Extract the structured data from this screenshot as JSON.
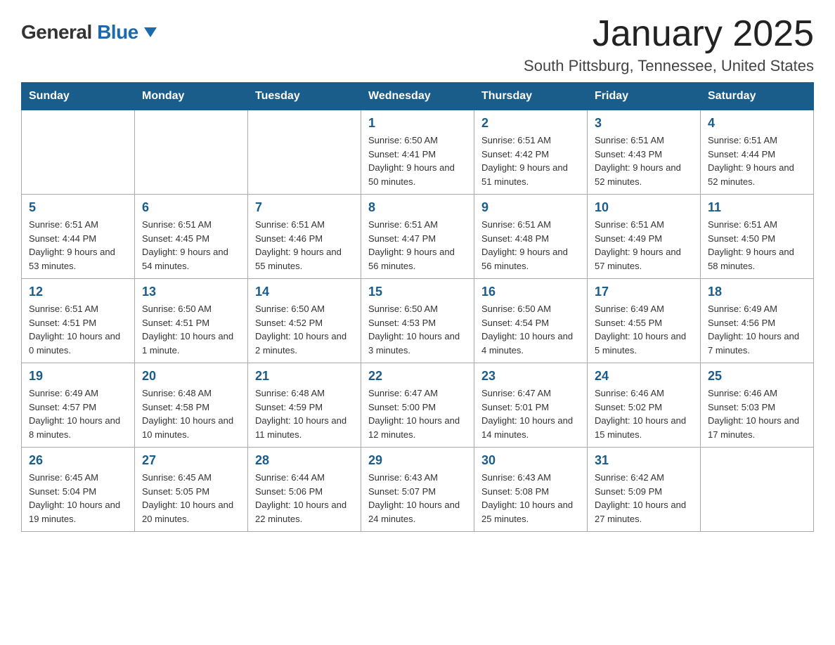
{
  "logo": {
    "text_general": "General",
    "text_blue": "Blue",
    "aria": "GeneralBlue logo"
  },
  "header": {
    "month_title": "January 2025",
    "location": "South Pittsburg, Tennessee, United States"
  },
  "weekdays": [
    "Sunday",
    "Monday",
    "Tuesday",
    "Wednesday",
    "Thursday",
    "Friday",
    "Saturday"
  ],
  "weeks": [
    [
      {
        "day": "",
        "info": ""
      },
      {
        "day": "",
        "info": ""
      },
      {
        "day": "",
        "info": ""
      },
      {
        "day": "1",
        "info": "Sunrise: 6:50 AM\nSunset: 4:41 PM\nDaylight: 9 hours\nand 50 minutes."
      },
      {
        "day": "2",
        "info": "Sunrise: 6:51 AM\nSunset: 4:42 PM\nDaylight: 9 hours\nand 51 minutes."
      },
      {
        "day": "3",
        "info": "Sunrise: 6:51 AM\nSunset: 4:43 PM\nDaylight: 9 hours\nand 52 minutes."
      },
      {
        "day": "4",
        "info": "Sunrise: 6:51 AM\nSunset: 4:44 PM\nDaylight: 9 hours\nand 52 minutes."
      }
    ],
    [
      {
        "day": "5",
        "info": "Sunrise: 6:51 AM\nSunset: 4:44 PM\nDaylight: 9 hours\nand 53 minutes."
      },
      {
        "day": "6",
        "info": "Sunrise: 6:51 AM\nSunset: 4:45 PM\nDaylight: 9 hours\nand 54 minutes."
      },
      {
        "day": "7",
        "info": "Sunrise: 6:51 AM\nSunset: 4:46 PM\nDaylight: 9 hours\nand 55 minutes."
      },
      {
        "day": "8",
        "info": "Sunrise: 6:51 AM\nSunset: 4:47 PM\nDaylight: 9 hours\nand 56 minutes."
      },
      {
        "day": "9",
        "info": "Sunrise: 6:51 AM\nSunset: 4:48 PM\nDaylight: 9 hours\nand 56 minutes."
      },
      {
        "day": "10",
        "info": "Sunrise: 6:51 AM\nSunset: 4:49 PM\nDaylight: 9 hours\nand 57 minutes."
      },
      {
        "day": "11",
        "info": "Sunrise: 6:51 AM\nSunset: 4:50 PM\nDaylight: 9 hours\nand 58 minutes."
      }
    ],
    [
      {
        "day": "12",
        "info": "Sunrise: 6:51 AM\nSunset: 4:51 PM\nDaylight: 10 hours\nand 0 minutes."
      },
      {
        "day": "13",
        "info": "Sunrise: 6:50 AM\nSunset: 4:51 PM\nDaylight: 10 hours\nand 1 minute."
      },
      {
        "day": "14",
        "info": "Sunrise: 6:50 AM\nSunset: 4:52 PM\nDaylight: 10 hours\nand 2 minutes."
      },
      {
        "day": "15",
        "info": "Sunrise: 6:50 AM\nSunset: 4:53 PM\nDaylight: 10 hours\nand 3 minutes."
      },
      {
        "day": "16",
        "info": "Sunrise: 6:50 AM\nSunset: 4:54 PM\nDaylight: 10 hours\nand 4 minutes."
      },
      {
        "day": "17",
        "info": "Sunrise: 6:49 AM\nSunset: 4:55 PM\nDaylight: 10 hours\nand 5 minutes."
      },
      {
        "day": "18",
        "info": "Sunrise: 6:49 AM\nSunset: 4:56 PM\nDaylight: 10 hours\nand 7 minutes."
      }
    ],
    [
      {
        "day": "19",
        "info": "Sunrise: 6:49 AM\nSunset: 4:57 PM\nDaylight: 10 hours\nand 8 minutes."
      },
      {
        "day": "20",
        "info": "Sunrise: 6:48 AM\nSunset: 4:58 PM\nDaylight: 10 hours\nand 10 minutes."
      },
      {
        "day": "21",
        "info": "Sunrise: 6:48 AM\nSunset: 4:59 PM\nDaylight: 10 hours\nand 11 minutes."
      },
      {
        "day": "22",
        "info": "Sunrise: 6:47 AM\nSunset: 5:00 PM\nDaylight: 10 hours\nand 12 minutes."
      },
      {
        "day": "23",
        "info": "Sunrise: 6:47 AM\nSunset: 5:01 PM\nDaylight: 10 hours\nand 14 minutes."
      },
      {
        "day": "24",
        "info": "Sunrise: 6:46 AM\nSunset: 5:02 PM\nDaylight: 10 hours\nand 15 minutes."
      },
      {
        "day": "25",
        "info": "Sunrise: 6:46 AM\nSunset: 5:03 PM\nDaylight: 10 hours\nand 17 minutes."
      }
    ],
    [
      {
        "day": "26",
        "info": "Sunrise: 6:45 AM\nSunset: 5:04 PM\nDaylight: 10 hours\nand 19 minutes."
      },
      {
        "day": "27",
        "info": "Sunrise: 6:45 AM\nSunset: 5:05 PM\nDaylight: 10 hours\nand 20 minutes."
      },
      {
        "day": "28",
        "info": "Sunrise: 6:44 AM\nSunset: 5:06 PM\nDaylight: 10 hours\nand 22 minutes."
      },
      {
        "day": "29",
        "info": "Sunrise: 6:43 AM\nSunset: 5:07 PM\nDaylight: 10 hours\nand 24 minutes."
      },
      {
        "day": "30",
        "info": "Sunrise: 6:43 AM\nSunset: 5:08 PM\nDaylight: 10 hours\nand 25 minutes."
      },
      {
        "day": "31",
        "info": "Sunrise: 6:42 AM\nSunset: 5:09 PM\nDaylight: 10 hours\nand 27 minutes."
      },
      {
        "day": "",
        "info": ""
      }
    ]
  ]
}
